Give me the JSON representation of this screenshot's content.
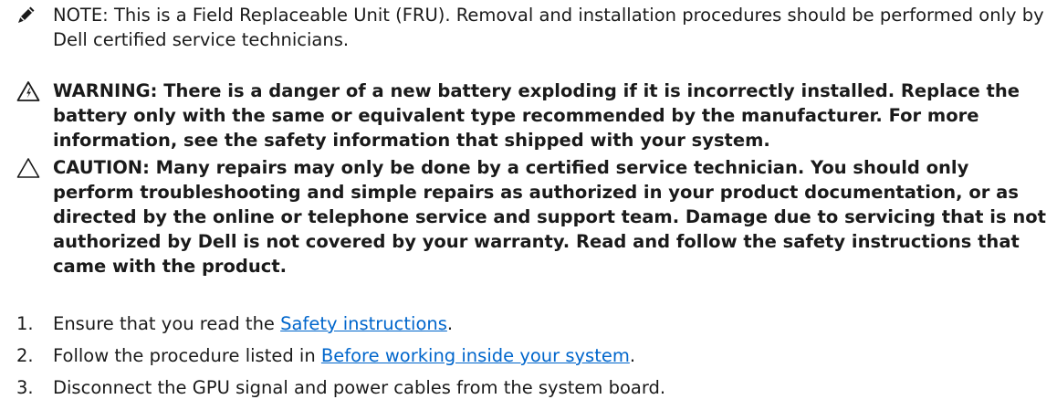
{
  "note": {
    "icon": "pencil-icon",
    "label": "NOTE:",
    "text": " This is a Field Replaceable Unit (FRU). Removal and installation procedures should be performed only by Dell certified service technicians."
  },
  "warning": {
    "icon": "warning-triangle-icon",
    "text": "WARNING: There is a danger of a new battery exploding if it is incorrectly installed. Replace the battery only with the same or equivalent type recommended by the manufacturer. For more information, see the safety information that shipped with your system."
  },
  "caution": {
    "icon": "caution-triangle-icon",
    "text": "CAUTION: Many repairs may only be done by a certified service technician. You should only perform troubleshooting and simple repairs as authorized in your product documentation, or as directed by the online or telephone service and support team. Damage due to servicing that is not authorized by Dell is not covered by your warranty. Read and follow the safety instructions that came with the product."
  },
  "steps": [
    {
      "number": "1.",
      "before": "Ensure that you read the ",
      "link": "Safety instructions",
      "after": "."
    },
    {
      "number": "2.",
      "before": "Follow the procedure listed in ",
      "link": "Before working inside your system",
      "after": "."
    },
    {
      "number": "3.",
      "before": "Disconnect the GPU signal and power cables from the system board.",
      "link": "",
      "after": ""
    }
  ]
}
